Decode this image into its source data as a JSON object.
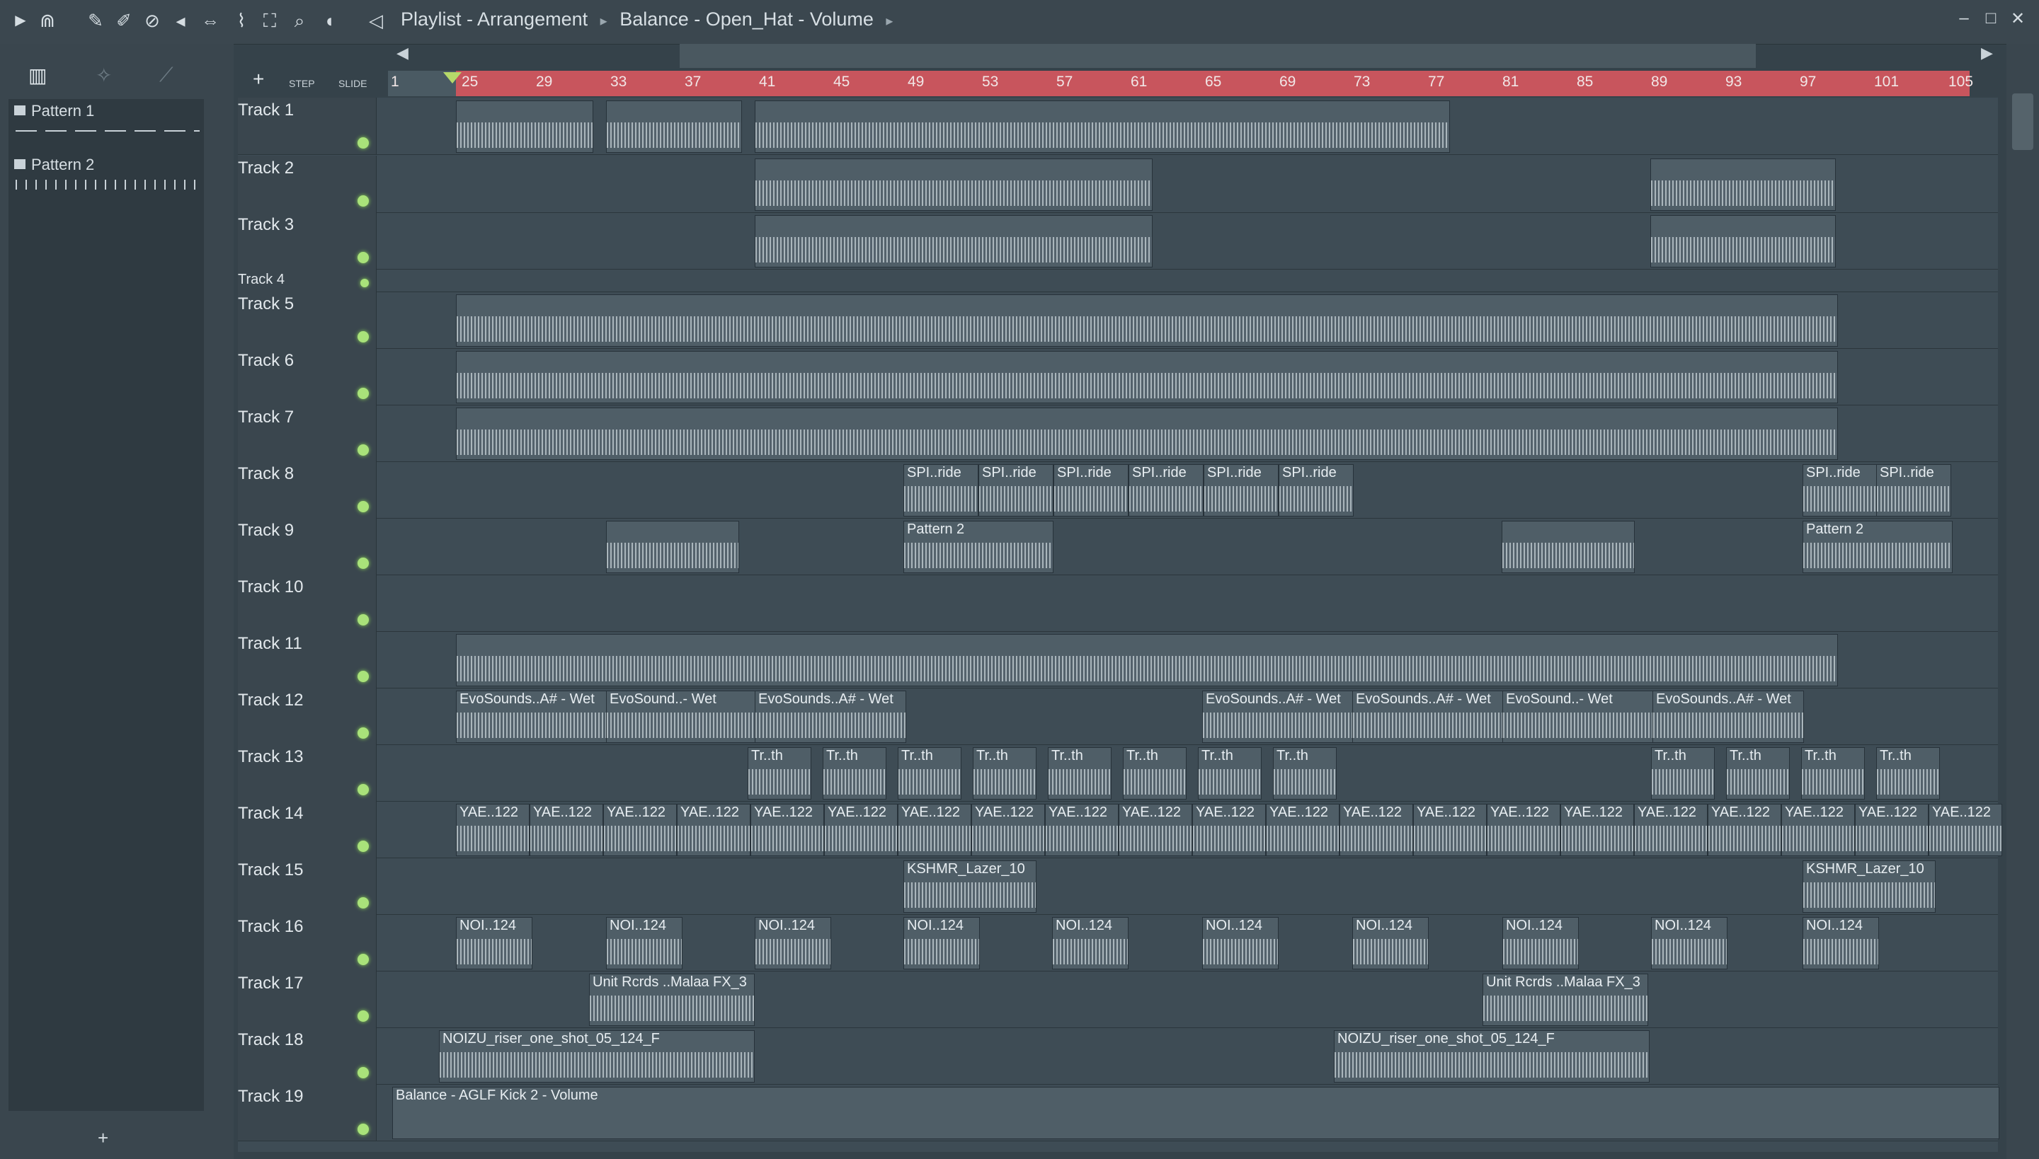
{
  "toolbar": {
    "breadcrumb": [
      "Playlist - Arrangement",
      "Balance - Open_Hat - Volume"
    ],
    "icons": [
      "play-icon",
      "magnet-icon",
      "pencil-icon",
      "brush-icon",
      "delete-icon",
      "mute-icon",
      "slip-icon",
      "slice-icon",
      "select-icon",
      "zoom-icon",
      "playback-icon",
      "speaker-icon"
    ]
  },
  "left_panel": {
    "patterns": [
      {
        "label": "Pattern 1"
      },
      {
        "label": "Pattern 2"
      }
    ],
    "add_label": "+",
    "step_label": "STEP",
    "slide_label": "SLIDE"
  },
  "ruler": {
    "first_label": "1",
    "bars": [
      "25",
      "29",
      "33",
      "37",
      "41",
      "45",
      "49",
      "53",
      "57",
      "61",
      "65",
      "69",
      "73",
      "77",
      "81",
      "85",
      "89",
      "93",
      "97",
      "101",
      "105"
    ]
  },
  "tracks": [
    {
      "name": "Track 1"
    },
    {
      "name": "Track 2"
    },
    {
      "name": "Track 3"
    },
    {
      "name": "Track 4"
    },
    {
      "name": "Track 5"
    },
    {
      "name": "Track 6"
    },
    {
      "name": "Track 7"
    },
    {
      "name": "Track 8"
    },
    {
      "name": "Track 9"
    },
    {
      "name": "Track 10"
    },
    {
      "name": "Track 11"
    },
    {
      "name": "Track 12"
    },
    {
      "name": "Track 13"
    },
    {
      "name": "Track 14"
    },
    {
      "name": "Track 15"
    },
    {
      "name": "Track 16"
    },
    {
      "name": "Track 17"
    },
    {
      "name": "Track 18"
    },
    {
      "name": "Track 19"
    }
  ],
  "clips": {
    "track8": [
      "SPI..ride",
      "SPI..ride",
      "SPI..ride",
      "SPI..ride",
      "SPI..ride",
      "SPI..ride",
      "SPI..ride",
      "SPI..ride"
    ],
    "track9": [
      "Pattern 2",
      "Pattern 2"
    ],
    "track12": [
      "EvoSounds..A# - Wet",
      "EvoSound..- Wet",
      "EvoSounds..A# - Wet",
      "EvoSounds..A# - Wet",
      "EvoSounds..A# - Wet",
      "EvoSound..- Wet",
      "EvoSounds..A# - Wet"
    ],
    "track13_label": "Tr..th",
    "track14_label": "YAE..122",
    "track15": [
      "KSHMR_Lazer_10",
      "KSHMR_Lazer_10"
    ],
    "track16_label": "NOI..124",
    "track17": [
      "Unit Rcrds ..Malaa FX_3",
      "Unit Rcrds ..Malaa FX_3"
    ],
    "track18": [
      "NOIZU_riser_one_shot_05_124_F",
      "NOIZU_riser_one_shot_05_124_F"
    ],
    "track19": [
      "Balance - AGLF Kick 2 - Volume"
    ],
    "track20_partial": "Balance - Open_Hat - Volume"
  }
}
